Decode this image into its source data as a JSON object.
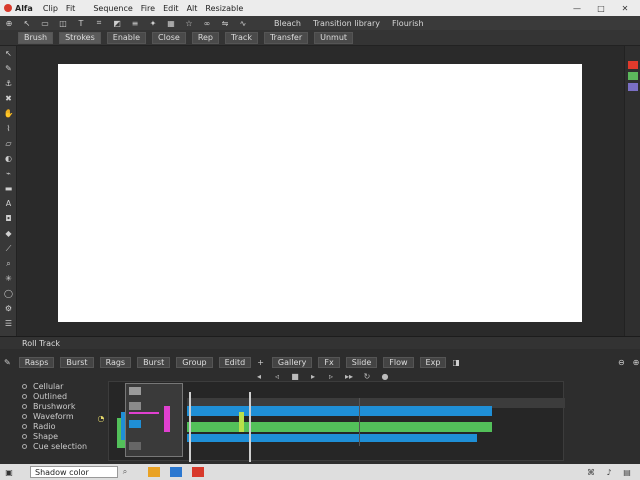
{
  "menubar": {
    "app_name": "Alfa",
    "items": [
      "Clip",
      "Fit",
      "Sequence",
      "Fire",
      "Edit",
      "Alt",
      "Resizable"
    ],
    "window_controls": [
      "—",
      "□",
      "✕"
    ]
  },
  "toolbar1": {
    "labels": [
      "Bleach",
      "Transition library",
      "Flourish"
    ]
  },
  "toolbar2": {
    "buttons": [
      "Brush",
      "Strokes",
      "Enable",
      "Close",
      "Rep",
      "Track",
      "Transfer",
      "Unmut"
    ]
  },
  "timeline": {
    "header": "Roll Track",
    "tabs": [
      "Rasps",
      "Burst",
      "Rags",
      "Burst",
      "Group",
      "Editd",
      "Gallery",
      "Fx",
      "Slide",
      "Flow",
      "Exp"
    ],
    "layers": [
      "Cellular",
      "Outlined",
      "Brushwork",
      "Waveform",
      "Radio",
      "Shape",
      "Cue selection"
    ]
  },
  "statusbar": {
    "search_value": "Shadow color"
  },
  "colors": {
    "swatch_red": "#e03a2c",
    "swatch_green": "#5cb85c",
    "swatch_purple": "#7a6fc4",
    "track_blue": "#1f8fd6",
    "track_green": "#53c05a",
    "marker_magenta": "#e040d0"
  }
}
